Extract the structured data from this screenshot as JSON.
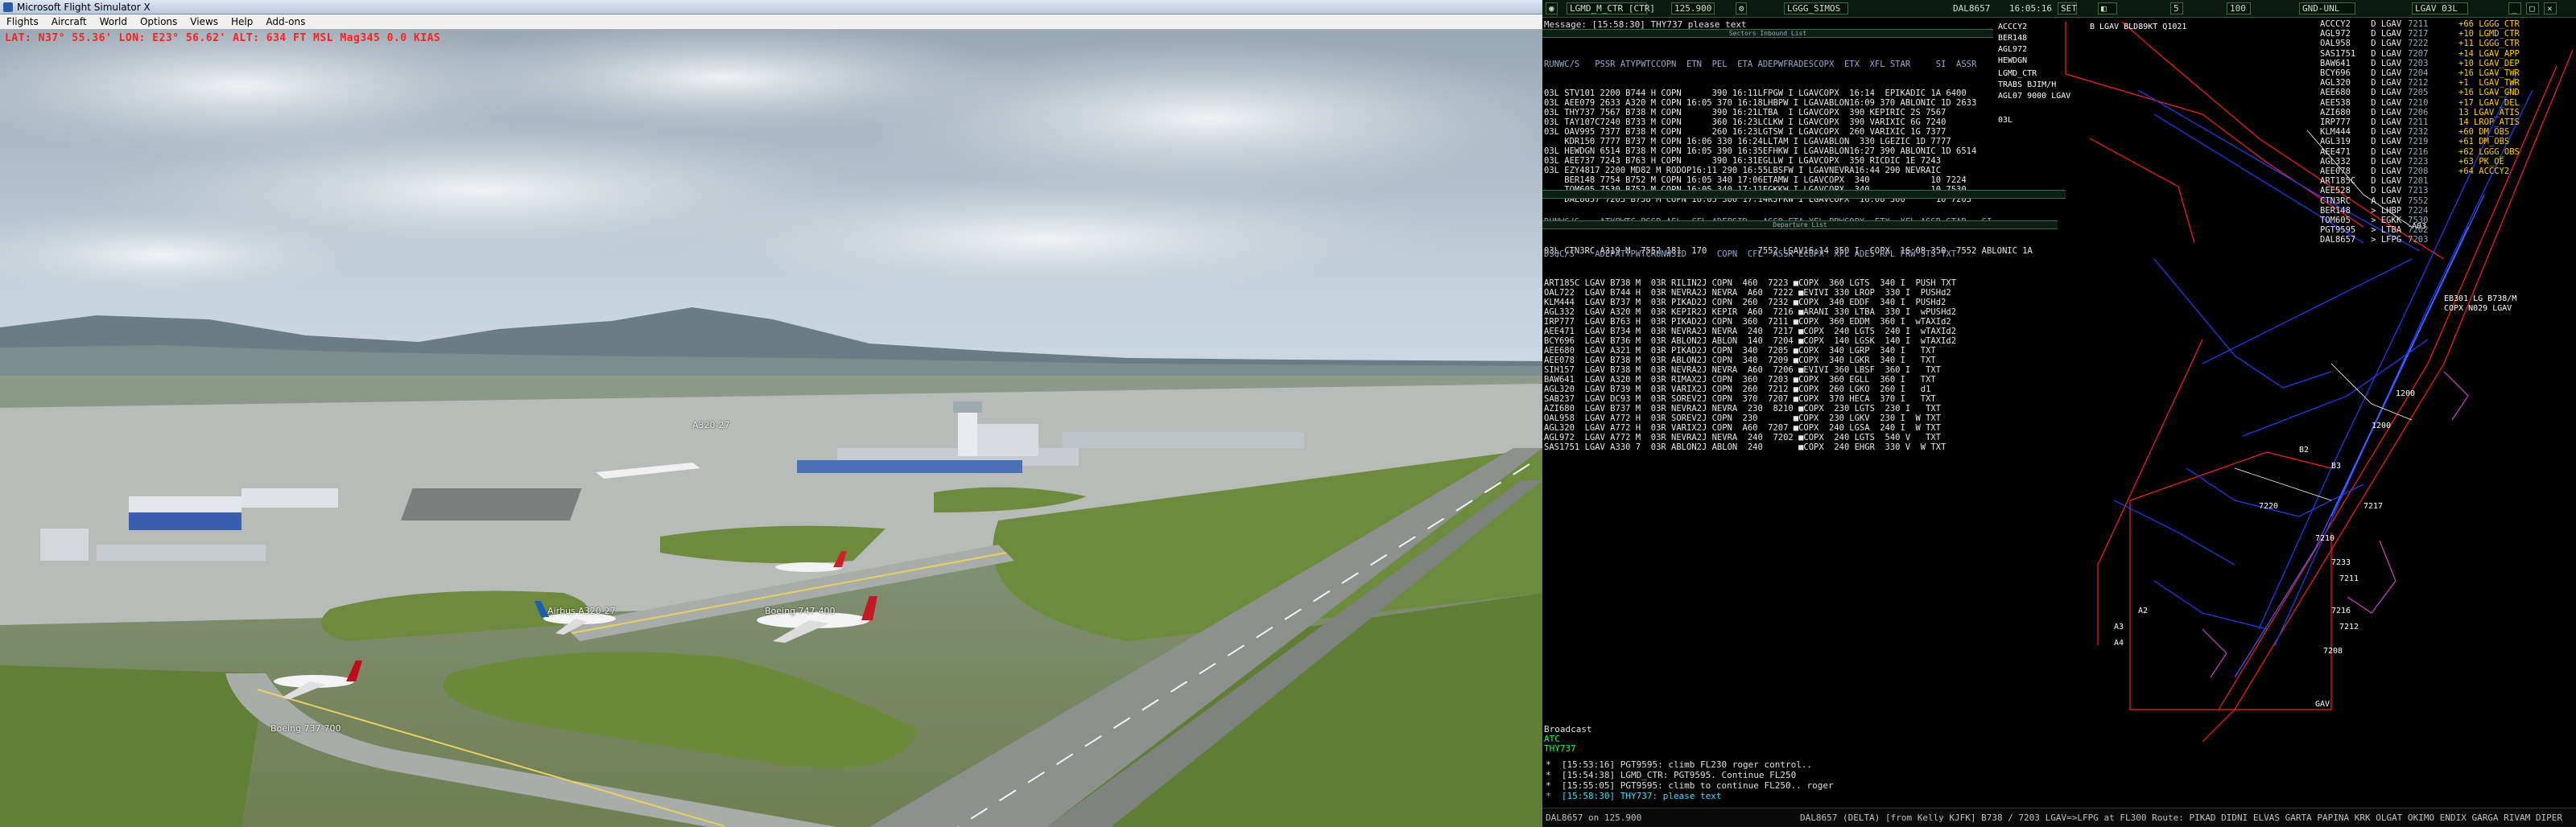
{
  "fsx": {
    "title": "Microsoft Flight Simulator X",
    "menu": [
      "Flights",
      "Aircraft",
      "World",
      "Options",
      "Views",
      "Help",
      "Add-ons"
    ],
    "info_line": "LAT: N37° 55.36'  LON: E23° 56.62'  ALT: 634 FT  MSL  Mag345  0.0 KIAS",
    "aircraft_labels": [
      {
        "text": "Boeing 737-700"
      },
      {
        "text": "Airbus A320-27"
      },
      {
        "text": "Boeing 747-400"
      },
      {
        "text": "A320-27"
      }
    ]
  },
  "es": {
    "topbar": {
      "callsign": "LGMD_M_CTR [CTR]",
      "freq": "125.900",
      "sector": "LGGG_SIMOS",
      "selected": "DAL8657",
      "time": "16:05:16",
      "gnd": "GND-UNL",
      "nm": "5",
      "alt": "100",
      "lgav": "LGAV 03L"
    },
    "message": "Message: [15:58:30] THY737 please text",
    "arrivals": {
      "title": "Sectors Inbound List",
      "header": "RUNWC/S   PSSR ATYPWTCCOPN  ETN  PEL  ETA ADEPWFRADESCOPX  ETX  XFL STAR     SI  ASSR",
      "rows": [
        "03L STV101 2200 B744 H COPN      390 16:11LFPGW I LGAVCOPX  16:14  EPIKADIC 1A 6400",
        "03L AEE079 2633 A320 M COPN 16:05 370 16:18LHBPW I LGAVABLON16:09 370 ABLONIC 1D 2633",
        "03L THY737 7567 B738 M COPN      390 16:21LTBA  I LGAVCOPX  390 KEPIRIC 2S 7567",
        "03L TAY107C7240 B733 M COPN      360 16:23LCLKW I LGAVCOPX  390 VARIXIC 6G 7240",
        "03L OAV995 7377 B738 M COPN      260 16:23LGTSW I LGAVCOPX  260 VARIXIC 1G 7377",
        "    KDR150 7777 B737 M COPN 16:06 330 16:24LLTAM I LGAVABLON  330 LGEZIC 1D 7777",
        "03L HEWDGN 6514 B738 M COPN 16:05 390 16:35EFHKW I LGAVABLON16:27 390 ABLONIC 1D 6514",
        "03L AEE737 7243 B763 H COPN      390 16:31EGLLW I LGAVCOPX  350 RICDIC 1E 7243",
        "03L EZY4817 2200 MD82 M RODOP16:11 290 16:55LBSFW I LGAVNEVRA16:44 290 NEVRAIC  ",
        "    BER148 7754 B752 M COPN 16:05 340 17:06ETAMW I LGAVCOPX  340            10 7224",
        "    TOM605 7530 B752 M COPN 16:05 340 17:11EGKKW I LGAVCOPX  340            10 7530",
        "    DAL8657 7203 B738 M COPN 16:05 300 17:14KJFKW I LGAVCOPX  16:08 300      10 7203"
      ]
    },
    "mid": {
      "title": "",
      "header": "RUNWC/S    ATYPWTC PSSR AFL  CFL ADEPSID   ASSR ETA XFL PRWCOPX  ETX  XFL ASSR STAR   SI",
      "rows": [
        "03L CTN3RC A319 M  7552 181  170          7552 LGAV16:14 350 I  COPX  16:08 350  7552 ABLONIC 1A"
      ]
    },
    "departures": {
      "title": "Departure List",
      "header": "DSQC/S    ADEPATYPWTCRUNWSID      COPN  CFL  ASSR ECOPX  XFL ADES RFL FRW STS TXT",
      "rows": [
        "ART185C LGAV B738 M  03R RILIN2J COPN  460  7223 ■COPX  360 LGTS  340 I  PUSH TXT",
        "OAL722  LGAV B744 H  03R NEVRA2J NEVRA  A60  7222 ■EVIVI 330 LROP  330 I  PUSHd2",
        "KLM444  LGAV B737 M  03R PIKAD2J COPN  260  7232 ■COPX  340 EDDF  340 I  PUSHd2",
        "AGL332  LGAV A320 M  03R KEPIR2J KEPIR  A60  7216 ■ARANI 330 LTBA  330 I  wPUSHd2",
        "IRP777  LGAV B763 H  03R PIKAD2J COPN  360  7211 ■COPX  360 EDDM  360 I  wTAXId2",
        "AEE471  LGAV B734 M  03R NEVRA2J NEVRA  240  7217 ■COPX  240 LGTS  240 I  wTAXId2",
        "BCY696  LGAV B736 M  03R ABLON2J ABLON  140  7204 ■COPX  140 LGSK  140 I  wTAXId2",
        "AEE680  LGAV A321 M  03R PIKAD2J COPN  340  7205 ■COPX  340 LGRP  340 I   TXT",
        "AEE078  LGAV B738 M  03R ABLON2J COPN  340  7209 ■COPX  340 LGKR  340 I   TXT",
        "SIH157  LGAV B738 M  03R NEVRA2J NEVRA  A60  7206 ■EVIVI 360 LBSF  360 I   TXT",
        "BAW641  LGAV A320 M  03R RIMAX2J COPN  360  7203 ■COPX  360 EGLL  360 I   TXT",
        "AGL320  LGAV B739 M  03R VARIX2J COPN  260  7212 ■COPX  260 LGKO  260 I   d1",
        "SAB237  LGAV DC93 M  03R SOREV2J COPN  370  7207 ■COPX  370 HECA  370 I   TXT",
        "AZI680  LGAV B737 M  03R NEVRA2J NEVRA  230  8210 ■COPX  230 LGTS  230 I   TXT",
        "OAL958  LGAV A772 H  03R SOREV2J COPN  230       ■COPX  230 LGKV  230 I  W TXT",
        "AGL320  LGAV A772 H  03R VARIX2J COPN  A60  7207 ■COPX  240 LGSA  240 I  W TXT",
        "AGL972  LGAV A772 M  03R NEVRA2J NEVRA  240  7202 ■COPX  240 LGTS  540 V   TXT",
        "SAS1751 LGAV A330 7  03R ABLON2J ABLON  240       ■COPX  240 EHGR  330 V  W TXT"
      ]
    },
    "right_callsigns": [
      "ACCCY2    D LGAV",
      "AGL972    D LGAV",
      "OAL958    D LGAV",
      "SAS1751   D LGAV",
      "BAW641    D LGAV",
      "BCY696    D LGAV",
      "AGL320    D LGAV",
      "AEE680    D LGAV",
      "AEE538    D LGAV",
      "AZI680    D LGAV",
      "IRP777    D LGAV",
      "KLM444    D LGAV",
      "AGL319    D LGAV",
      "AEE471    D LGAV",
      "AGL332    D LGAV",
      "AEE078    D LGAV",
      "ART185C   D LGAV",
      "AEE528    D LGAV",
      "CTN3RC    A LGAV",
      "BER148    > LHBP",
      "TOM605    > EGKK",
      "PGT9595   > LTBA",
      "DAL8657   > LFPG"
    ],
    "right_codes": [
      "7211",
      "7217",
      "7222",
      "7207",
      "7203",
      "7204",
      "7212",
      "7205",
      "7210",
      "7206",
      "7211",
      "7232",
      "7219",
      "7216",
      "7223",
      "7208",
      "7201",
      "7213",
      "7552",
      "7224",
      "7530",
      "7202",
      "7203"
    ],
    "freq_list": [
      "+66 LGGG_CTR",
      "+10 LGMD_CTR",
      "+11 LGGG_CTR",
      "+14 LGAV_APP",
      "+10 LGAV_DEP",
      "+16 LGAV_TWR",
      "+1  LGAV_TWR",
      "+16 LGAV_GND",
      "+17 LGAV_DEL",
      "13 LGAV_ATIS",
      "14 LROP_ATIS",
      "+60 DM_OBS",
      "+61 DM_OBS",
      "+62 LGGG_OBS",
      "+63 PK_OE",
      "+64 ACCCY2"
    ],
    "radar_labels": [
      {
        "t": "ACCCY2"
      },
      {
        "t": "BER148"
      },
      {
        "t": "AGL972"
      },
      {
        "t": "HEWDGN"
      },
      {
        "t": "LGMD_CTR"
      },
      {
        "t": "TRABS   BJIM/H"
      },
      {
        "t": "AGL07 9000 LGAV"
      },
      {
        "t": "03L"
      },
      {
        "t": "7220"
      },
      {
        "t": "7217"
      },
      {
        "t": "7211"
      },
      {
        "t": "7216"
      },
      {
        "t": "7212"
      },
      {
        "t": "7208"
      },
      {
        "t": "1200"
      },
      {
        "t": "A03"
      },
      {
        "t": "EB301 LG B738/M"
      },
      {
        "t": "COPX N029 LGAV"
      },
      {
        "t": "1200"
      },
      {
        "t": "7210"
      },
      {
        "t": "7233"
      },
      {
        "t": "B LGAV BLD89KT Q1021"
      },
      {
        "t": "GAV"
      },
      {
        "t": "A3"
      },
      {
        "t": "A2"
      },
      {
        "t": "A4"
      },
      {
        "t": "B2"
      },
      {
        "t": "B3"
      }
    ],
    "chat": {
      "tab1": "Broadcast",
      "tab2": "ATC",
      "tab3": "THY737",
      "lines": [
        "*  [15:53:16] PGT9595: climb FL230 roger control..",
        "*  [15:54:38] LGMD_CTR: PGT9595. Continue FL250",
        "*  [15:55:05] PGT9595: climb to continue FL250.. roger",
        "*  [15:58:30] THY737: please text"
      ]
    },
    "status": {
      "left": "DAL8657 on 125.900",
      "right": "DAL8657 (DELTA) [from Kelly KJFK] B738 / 7203 LGAV=>LFPG at FL300 Route: PIKAD DIDNI ELVAS GARTA PAPINA KRK OLGAT OKIMO ENDIX GARGA RIVAM DIPER"
    },
    "colors": {
      "runway_red": "#ff2020",
      "taxi_blue": "#2040ff",
      "label_white": "#ffffff",
      "list_green": "#1a3a24"
    }
  }
}
